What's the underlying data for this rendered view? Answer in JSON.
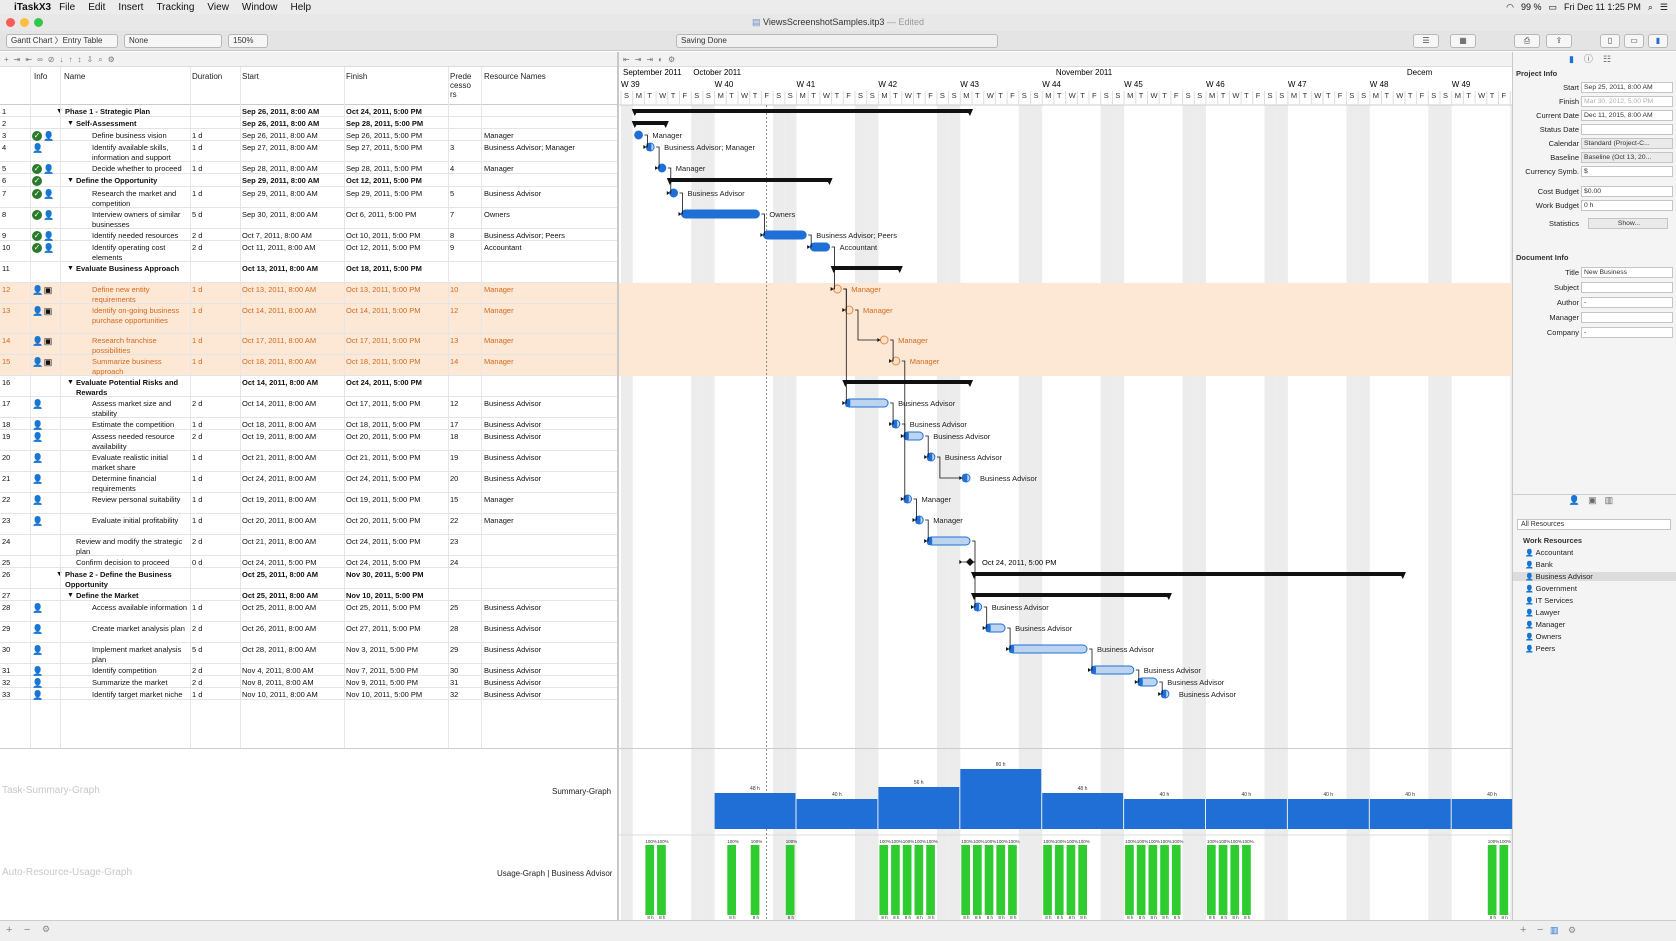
{
  "menubar": {
    "app": "iTaskX3",
    "items": [
      "File",
      "Edit",
      "Insert",
      "Tracking",
      "View",
      "Window",
      "Help"
    ],
    "battery": "99 %",
    "clock": "Fri Dec 11  1:25 PM"
  },
  "window": {
    "title": "ViewsScreenshotSamples.itp3",
    "edited": "— Edited"
  },
  "toolbar": {
    "view_selector": "Gantt Chart 〉Entry Table",
    "filter": "None",
    "zoom": "150%",
    "status": "Saving Done"
  },
  "columns": {
    "info": "Info",
    "name": "Name",
    "duration": "Duration",
    "start": "Start",
    "finish": "Finish",
    "predecessors": "Prede\ncesso\nrs",
    "resources": "Resource Names"
  },
  "tasks": [
    {
      "id": "1",
      "name": "Phase 1 - Strategic Plan",
      "dur": "",
      "start": "Sep 26, 2011, 8:00 AM",
      "finish": "Oct 24, 2011, 5:00 PM",
      "pred": "",
      "res": "",
      "summary": true,
      "indent": 0,
      "info": "",
      "sel": false
    },
    {
      "id": "2",
      "name": "Self-Assessment",
      "dur": "",
      "start": "Sep 26, 2011, 8:00 AM",
      "finish": "Sep 28, 2011, 5:00 PM",
      "pred": "",
      "res": "",
      "summary": true,
      "indent": 1,
      "info": "",
      "sel": false
    },
    {
      "id": "3",
      "name": "Define business vision",
      "dur": "1 d",
      "start": "Sep 26, 2011, 8:00 AM",
      "finish": "Sep 26, 2011, 5:00 PM",
      "pred": "",
      "res": "Manager",
      "summary": false,
      "indent": 2,
      "info": "cp",
      "sel": false
    },
    {
      "id": "4",
      "name": "Identify available skills, information and support",
      "dur": "1 d",
      "start": "Sep 27, 2011, 8:00 AM",
      "finish": "Sep 27, 2011, 5:00 PM",
      "pred": "3",
      "res": "Business Advisor; Manager",
      "summary": false,
      "indent": 2,
      "info": "p",
      "sel": false
    },
    {
      "id": "5",
      "name": "Decide whether to proceed",
      "dur": "1 d",
      "start": "Sep 28, 2011, 8:00 AM",
      "finish": "Sep 28, 2011, 5:00 PM",
      "pred": "4",
      "res": "Manager",
      "summary": false,
      "indent": 2,
      "info": "cp",
      "sel": false
    },
    {
      "id": "6",
      "name": "Define the Opportunity",
      "dur": "",
      "start": "Sep 29, 2011, 8:00 AM",
      "finish": "Oct 12, 2011, 5:00 PM",
      "pred": "",
      "res": "",
      "summary": true,
      "indent": 1,
      "info": "c",
      "sel": false
    },
    {
      "id": "7",
      "name": "Research the market and competition",
      "dur": "1 d",
      "start": "Sep 29, 2011, 8:00 AM",
      "finish": "Sep 29, 2011, 5:00 PM",
      "pred": "5",
      "res": "Business Advisor",
      "summary": false,
      "indent": 2,
      "info": "cp",
      "sel": false
    },
    {
      "id": "8",
      "name": "Interview owners of similar businesses",
      "dur": "5 d",
      "start": "Sep 30, 2011, 8:00 AM",
      "finish": "Oct 6, 2011, 5:00 PM",
      "pred": "7",
      "res": "Owners",
      "summary": false,
      "indent": 2,
      "info": "cp",
      "sel": false
    },
    {
      "id": "9",
      "name": "Identify needed resources",
      "dur": "2 d",
      "start": "Oct 7, 2011, 8:00 AM",
      "finish": "Oct 10, 2011, 5:00 PM",
      "pred": "8",
      "res": "Business Advisor; Peers",
      "summary": false,
      "indent": 2,
      "info": "cp",
      "sel": false
    },
    {
      "id": "10",
      "name": "Identify operating cost elements",
      "dur": "2 d",
      "start": "Oct 11, 2011, 8:00 AM",
      "finish": "Oct 12, 2011, 5:00 PM",
      "pred": "9",
      "res": "Accountant",
      "summary": false,
      "indent": 2,
      "info": "cp",
      "sel": false
    },
    {
      "id": "11",
      "name": "Evaluate Business Approach",
      "dur": "",
      "start": "Oct 13, 2011, 8:00 AM",
      "finish": "Oct 18, 2011, 5:00 PM",
      "pred": "",
      "res": "",
      "summary": true,
      "indent": 1,
      "info": "",
      "sel": false
    },
    {
      "id": "12",
      "name": "Define new entity requirements",
      "dur": "1 d",
      "start": "Oct 13, 2011, 8:00 AM",
      "finish": "Oct 13, 2011, 5:00 PM",
      "pred": "10",
      "res": "Manager",
      "summary": false,
      "indent": 2,
      "info": "pn",
      "sel": true
    },
    {
      "id": "13",
      "name": "Identify on-going business purchase opportunities",
      "dur": "1 d",
      "start": "Oct 14, 2011, 8:00 AM",
      "finish": "Oct 14, 2011, 5:00 PM",
      "pred": "12",
      "res": "Manager",
      "summary": false,
      "indent": 2,
      "info": "pn",
      "sel": true
    },
    {
      "id": "14",
      "name": "Research franchise possibilities",
      "dur": "1 d",
      "start": "Oct 17, 2011, 8:00 AM",
      "finish": "Oct 17, 2011, 5:00 PM",
      "pred": "13",
      "res": "Manager",
      "summary": false,
      "indent": 2,
      "info": "pn",
      "sel": true
    },
    {
      "id": "15",
      "name": "Summarize business approach",
      "dur": "1 d",
      "start": "Oct 18, 2011, 8:00 AM",
      "finish": "Oct 18, 2011, 5:00 PM",
      "pred": "14",
      "res": "Manager",
      "summary": false,
      "indent": 2,
      "info": "pn",
      "sel": true
    },
    {
      "id": "16",
      "name": "Evaluate Potential Risks and Rewards",
      "dur": "",
      "start": "Oct 14, 2011, 8:00 AM",
      "finish": "Oct 24, 2011, 5:00 PM",
      "pred": "",
      "res": "",
      "summary": true,
      "indent": 1,
      "info": "",
      "sel": false
    },
    {
      "id": "17",
      "name": "Assess market size and stability",
      "dur": "2 d",
      "start": "Oct 14, 2011, 8:00 AM",
      "finish": "Oct 17, 2011, 5:00 PM",
      "pred": "12",
      "res": "Business Advisor",
      "summary": false,
      "indent": 2,
      "info": "p",
      "sel": false
    },
    {
      "id": "18",
      "name": "Estimate the competition",
      "dur": "1 d",
      "start": "Oct 18, 2011, 8:00 AM",
      "finish": "Oct 18, 2011, 5:00 PM",
      "pred": "17",
      "res": "Business Advisor",
      "summary": false,
      "indent": 2,
      "info": "p",
      "sel": false
    },
    {
      "id": "19",
      "name": "Assess needed resource availability",
      "dur": "2 d",
      "start": "Oct 19, 2011, 8:00 AM",
      "finish": "Oct 20, 2011, 5:00 PM",
      "pred": "18",
      "res": "Business Advisor",
      "summary": false,
      "indent": 2,
      "info": "p",
      "sel": false
    },
    {
      "id": "20",
      "name": "Evaluate realistic initial market share",
      "dur": "1 d",
      "start": "Oct 21, 2011, 8:00 AM",
      "finish": "Oct 21, 2011, 5:00 PM",
      "pred": "19",
      "res": "Business Advisor",
      "summary": false,
      "indent": 2,
      "info": "p",
      "sel": false
    },
    {
      "id": "21",
      "name": "Determine financial requirements",
      "dur": "1 d",
      "start": "Oct 24, 2011, 8:00 AM",
      "finish": "Oct 24, 2011, 5:00 PM",
      "pred": "20",
      "res": "Business Advisor",
      "summary": false,
      "indent": 2,
      "info": "p",
      "sel": false
    },
    {
      "id": "22",
      "name": "Review personal suitability",
      "dur": "1 d",
      "start": "Oct 19, 2011, 8:00 AM",
      "finish": "Oct 19, 2011, 5:00 PM",
      "pred": "15",
      "res": "Manager",
      "summary": false,
      "indent": 2,
      "info": "p",
      "sel": false
    },
    {
      "id": "23",
      "name": "Evaluate initial profitability",
      "dur": "1 d",
      "start": "Oct 20, 2011, 8:00 AM",
      "finish": "Oct 20, 2011, 5:00 PM",
      "pred": "22",
      "res": "Manager",
      "summary": false,
      "indent": 2,
      "info": "p",
      "sel": false
    },
    {
      "id": "24",
      "name": "Review and modify the strategic plan",
      "dur": "2 d",
      "start": "Oct 21, 2011, 8:00 AM",
      "finish": "Oct 24, 2011, 5:00 PM",
      "pred": "23",
      "res": "",
      "summary": false,
      "indent": 1,
      "info": "",
      "sel": false
    },
    {
      "id": "25",
      "name": "Confirm decision to proceed",
      "dur": "0 d",
      "start": "Oct 24, 2011, 5:00 PM",
      "finish": "Oct 24, 2011, 5:00 PM",
      "pred": "24",
      "res": "",
      "summary": false,
      "indent": 1,
      "info": "",
      "sel": false
    },
    {
      "id": "26",
      "name": "Phase 2 - Define the Business Opportunity",
      "dur": "",
      "start": "Oct 25, 2011, 8:00 AM",
      "finish": "Nov 30, 2011, 5:00 PM",
      "pred": "",
      "res": "",
      "summary": true,
      "indent": 0,
      "info": "",
      "sel": false
    },
    {
      "id": "27",
      "name": "Define the Market",
      "dur": "",
      "start": "Oct 25, 2011, 8:00 AM",
      "finish": "Nov 10, 2011, 5:00 PM",
      "pred": "",
      "res": "",
      "summary": true,
      "indent": 1,
      "info": "",
      "sel": false
    },
    {
      "id": "28",
      "name": "Access available information",
      "dur": "1 d",
      "start": "Oct 25, 2011, 8:00 AM",
      "finish": "Oct 25, 2011, 5:00 PM",
      "pred": "25",
      "res": "Business Advisor",
      "summary": false,
      "indent": 2,
      "info": "p",
      "sel": false
    },
    {
      "id": "29",
      "name": "Create market analysis plan",
      "dur": "2 d",
      "start": "Oct 26, 2011, 8:00 AM",
      "finish": "Oct 27, 2011, 5:00 PM",
      "pred": "28",
      "res": "Business Advisor",
      "summary": false,
      "indent": 2,
      "info": "p",
      "sel": false
    },
    {
      "id": "30",
      "name": "Implement market analysis plan",
      "dur": "5 d",
      "start": "Oct 28, 2011, 8:00 AM",
      "finish": "Nov 3, 2011, 5:00 PM",
      "pred": "29",
      "res": "Business Advisor",
      "summary": false,
      "indent": 2,
      "info": "p",
      "sel": false
    },
    {
      "id": "31",
      "name": "Identify competition",
      "dur": "2 d",
      "start": "Nov 4, 2011, 8:00 AM",
      "finish": "Nov 7, 2011, 5:00 PM",
      "pred": "30",
      "res": "Business Advisor",
      "summary": false,
      "indent": 2,
      "info": "p",
      "sel": false
    },
    {
      "id": "32",
      "name": "Summarize the market",
      "dur": "2 d",
      "start": "Nov 8, 2011, 8:00 AM",
      "finish": "Nov 9, 2011, 5:00 PM",
      "pred": "31",
      "res": "Business Advisor",
      "summary": false,
      "indent": 2,
      "info": "p",
      "sel": false
    },
    {
      "id": "33",
      "name": "Identify target market niche",
      "dur": "1 d",
      "start": "Nov 10, 2011, 8:00 AM",
      "finish": "Nov 10, 2011, 5:00 PM",
      "pred": "32",
      "res": "Business Advisor",
      "summary": false,
      "indent": 2,
      "info": "p",
      "sel": false
    }
  ],
  "timeline": {
    "months": [
      "September 2011",
      "October 2011",
      "November 2011",
      "Decem"
    ],
    "weeks": [
      "W 39",
      "W 40",
      "W 41",
      "W 42",
      "W 43",
      "W 44",
      "W 45",
      "W 46",
      "W 47",
      "W 48",
      "W 49"
    ],
    "day_letters": [
      "S",
      "M",
      "T",
      "W",
      "T",
      "F",
      "S"
    ],
    "milestone_label": "Oct 24, 2011, 5:00 PM"
  },
  "graphs": {
    "task_summary_watermark": "Task-Summary-Graph",
    "task_summary_name": "Summary-Graph",
    "usage_watermark": "Auto-Resource-Usage-Graph",
    "usage_name": "Usage-Graph | Business Advisor",
    "weekly_hours": [
      "48 h",
      "40 h",
      "56 h",
      "80 h",
      "48 h",
      "40 h",
      "40 h",
      "40 h",
      "40 h",
      "40 h"
    ],
    "usage_bar_label": "100%",
    "usage_base_label": "8 h"
  },
  "inspector": {
    "project_info_title": "Project Info",
    "project_fields": [
      {
        "label": "Start",
        "value": "Sep 25, 2011, 8:00 AM",
        "style": "normal"
      },
      {
        "label": "Finish",
        "value": "Mar 30, 2012, 5:00 PM",
        "style": "gray"
      },
      {
        "label": "Current Date",
        "value": "Dec 11, 2015, 8:00 AM",
        "style": "normal"
      },
      {
        "label": "Status Date",
        "value": "",
        "style": "normal"
      },
      {
        "label": "Calendar",
        "value": "Standard (Project-C...",
        "style": "pop"
      },
      {
        "label": "Baseline",
        "value": "Baseline (Oct 13, 20...",
        "style": "pop"
      },
      {
        "label": "Currency Symb.",
        "value": "$",
        "style": "normal"
      },
      {
        "label": "Cost Budget",
        "value": "$0.00",
        "style": "normal"
      },
      {
        "label": "Work Budget",
        "value": "0 h",
        "style": "normal"
      },
      {
        "label": "Statistics",
        "value": "Show...",
        "style": "pop"
      }
    ],
    "document_info_title": "Document Info",
    "doc_fields": [
      {
        "label": "Title",
        "value": "New Business"
      },
      {
        "label": "Subject",
        "value": ""
      },
      {
        "label": "Author",
        "value": "-"
      },
      {
        "label": "Manager",
        "value": ""
      },
      {
        "label": "Company",
        "value": "-"
      }
    ],
    "resource_filter": "All Resources",
    "work_resources_title": "Work Resources",
    "resources": [
      "Accountant",
      "Bank",
      "Business Advisor",
      "Government",
      "IT Services",
      "Lawyer",
      "Manager",
      "Owners",
      "Peers"
    ],
    "selected_resource": "Business Advisor"
  },
  "colors": {
    "accent_blue": "#1f6fd6",
    "selected_row": "#fde8d6",
    "selected_text": "#d2691e",
    "usage_green": "#2ecc2e",
    "complete_green": "#2b7a2b"
  }
}
